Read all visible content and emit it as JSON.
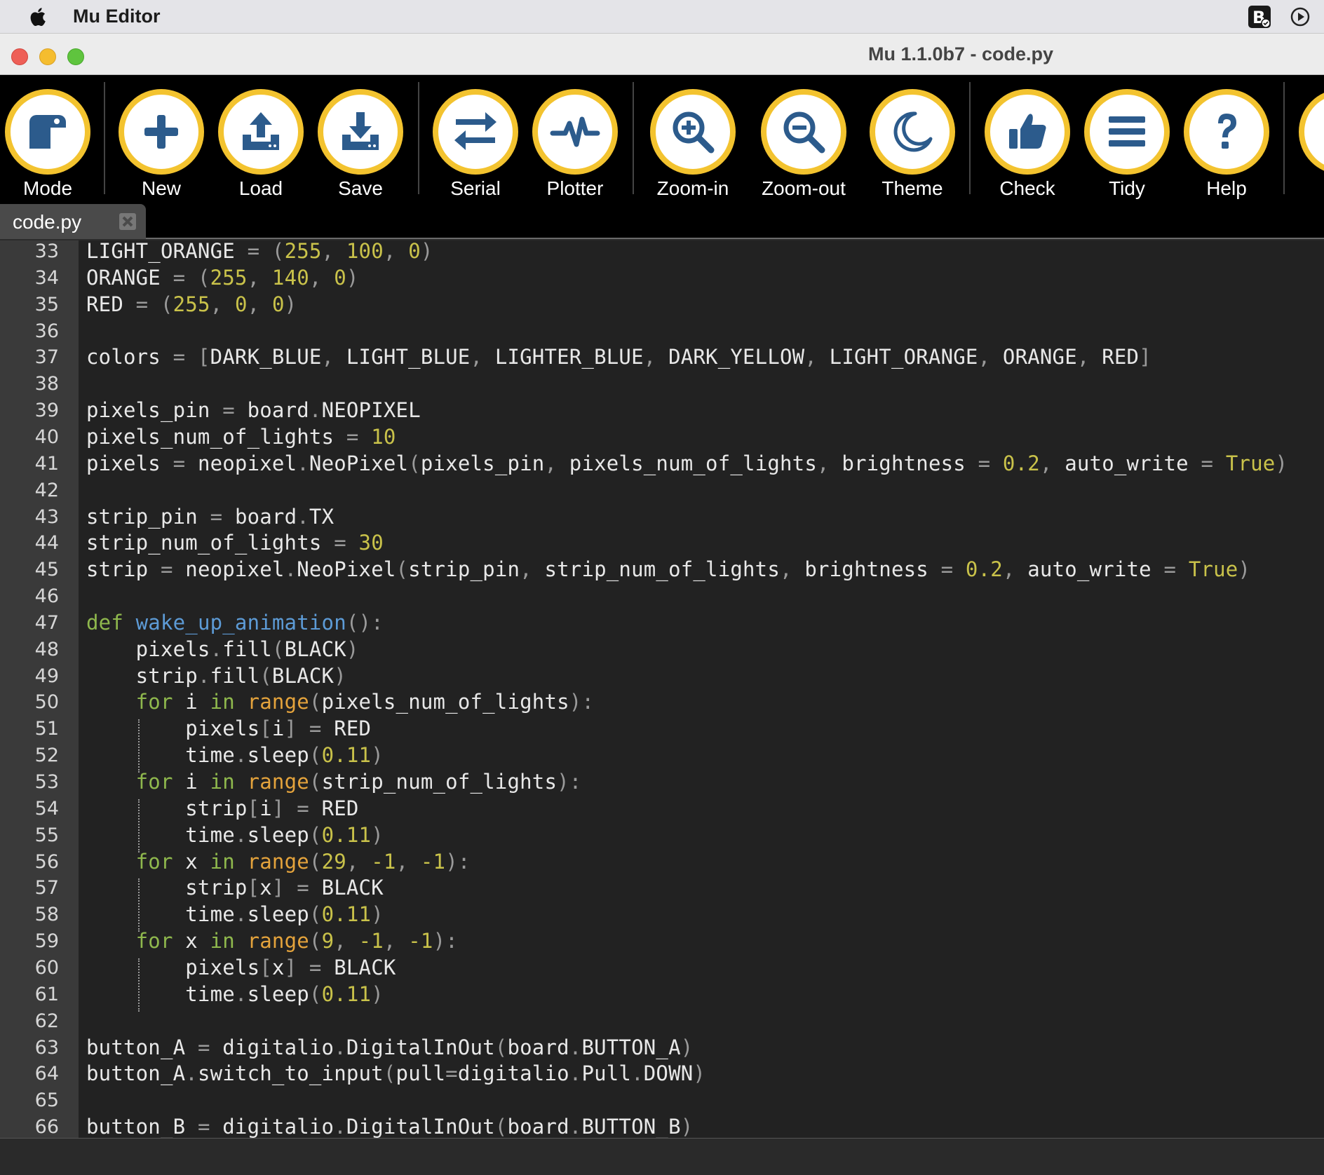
{
  "menubar": {
    "app_name": "Mu Editor",
    "icons": [
      "apple-icon",
      "bbedit-icon",
      "play-circle-icon"
    ]
  },
  "window": {
    "title": "Mu 1.1.0b7 - code.py"
  },
  "toolbar": {
    "buttons": [
      {
        "label": "Mode",
        "icon": "mode-icon"
      },
      {
        "label": "New",
        "icon": "plus-icon"
      },
      {
        "label": "Load",
        "icon": "upload-icon"
      },
      {
        "label": "Save",
        "icon": "download-icon"
      },
      {
        "label": "Serial",
        "icon": "arrows-icon"
      },
      {
        "label": "Plotter",
        "icon": "pulse-icon"
      },
      {
        "label": "Zoom-in",
        "icon": "zoom-in-icon"
      },
      {
        "label": "Zoom-out",
        "icon": "zoom-out-icon"
      },
      {
        "label": "Theme",
        "icon": "moon-icon"
      },
      {
        "label": "Check",
        "icon": "thumbs-up-icon"
      },
      {
        "label": "Tidy",
        "icon": "lines-icon"
      },
      {
        "label": "Help",
        "icon": "question-icon"
      }
    ],
    "accent_color": "#f3c32f",
    "icon_color": "#2c5b8c"
  },
  "tabs": [
    {
      "label": "code.py",
      "close_icon": "close-icon"
    }
  ],
  "colors": {
    "keyword": "#8fb84d",
    "function_def": "#5d9bd6",
    "builtin": "#e4a33c",
    "number": "#c9c24a",
    "punct": "#9a9a9a",
    "text": "#e8e8e8"
  },
  "editor": {
    "lines": [
      {
        "n": "33",
        "tokens": [
          [
            "t",
            "LIGHT_ORANGE "
          ],
          [
            "p",
            "= ("
          ],
          [
            "n",
            "255"
          ],
          [
            "p",
            ", "
          ],
          [
            "n",
            "100"
          ],
          [
            "p",
            ", "
          ],
          [
            "n",
            "0"
          ],
          [
            "p",
            ")"
          ]
        ]
      },
      {
        "n": "34",
        "tokens": [
          [
            "t",
            "ORANGE "
          ],
          [
            "p",
            "= ("
          ],
          [
            "n",
            "255"
          ],
          [
            "p",
            ", "
          ],
          [
            "n",
            "140"
          ],
          [
            "p",
            ", "
          ],
          [
            "n",
            "0"
          ],
          [
            "p",
            ")"
          ]
        ]
      },
      {
        "n": "35",
        "tokens": [
          [
            "t",
            "RED "
          ],
          [
            "p",
            "= ("
          ],
          [
            "n",
            "255"
          ],
          [
            "p",
            ", "
          ],
          [
            "n",
            "0"
          ],
          [
            "p",
            ", "
          ],
          [
            "n",
            "0"
          ],
          [
            "p",
            ")"
          ]
        ]
      },
      {
        "n": "36",
        "tokens": []
      },
      {
        "n": "37",
        "tokens": [
          [
            "t",
            "colors "
          ],
          [
            "p",
            "= ["
          ],
          [
            "t",
            "DARK_BLUE"
          ],
          [
            "p",
            ", "
          ],
          [
            "t",
            "LIGHT_BLUE"
          ],
          [
            "p",
            ", "
          ],
          [
            "t",
            "LIGHTER_BLUE"
          ],
          [
            "p",
            ", "
          ],
          [
            "t",
            "DARK_YELLOW"
          ],
          [
            "p",
            ", "
          ],
          [
            "t",
            "LIGHT_ORANGE"
          ],
          [
            "p",
            ", "
          ],
          [
            "t",
            "ORANGE"
          ],
          [
            "p",
            ", "
          ],
          [
            "t",
            "RED"
          ],
          [
            "p",
            "]"
          ]
        ]
      },
      {
        "n": "38",
        "tokens": []
      },
      {
        "n": "39",
        "tokens": [
          [
            "t",
            "pixels_pin "
          ],
          [
            "p",
            "= "
          ],
          [
            "t",
            "board"
          ],
          [
            "p",
            "."
          ],
          [
            "t",
            "NEOPIXEL"
          ]
        ]
      },
      {
        "n": "40",
        "tokens": [
          [
            "t",
            "pixels_num_of_lights "
          ],
          [
            "p",
            "= "
          ],
          [
            "n",
            "10"
          ]
        ]
      },
      {
        "n": "41",
        "tokens": [
          [
            "t",
            "pixels "
          ],
          [
            "p",
            "= "
          ],
          [
            "t",
            "neopixel"
          ],
          [
            "p",
            "."
          ],
          [
            "t",
            "NeoPixel"
          ],
          [
            "p",
            "("
          ],
          [
            "t",
            "pixels_pin"
          ],
          [
            "p",
            ", "
          ],
          [
            "t",
            "pixels_num_of_lights"
          ],
          [
            "p",
            ", "
          ],
          [
            "t",
            "brightness "
          ],
          [
            "p",
            "= "
          ],
          [
            "n",
            "0.2"
          ],
          [
            "p",
            ", "
          ],
          [
            "t",
            "auto_write "
          ],
          [
            "p",
            "= "
          ],
          [
            "n",
            "True"
          ],
          [
            "p",
            ")"
          ]
        ]
      },
      {
        "n": "42",
        "tokens": []
      },
      {
        "n": "43",
        "tokens": [
          [
            "t",
            "strip_pin "
          ],
          [
            "p",
            "= "
          ],
          [
            "t",
            "board"
          ],
          [
            "p",
            "."
          ],
          [
            "t",
            "TX"
          ]
        ]
      },
      {
        "n": "44",
        "tokens": [
          [
            "t",
            "strip_num_of_lights "
          ],
          [
            "p",
            "= "
          ],
          [
            "n",
            "30"
          ]
        ]
      },
      {
        "n": "45",
        "tokens": [
          [
            "t",
            "strip "
          ],
          [
            "p",
            "= "
          ],
          [
            "t",
            "neopixel"
          ],
          [
            "p",
            "."
          ],
          [
            "t",
            "NeoPixel"
          ],
          [
            "p",
            "("
          ],
          [
            "t",
            "strip_pin"
          ],
          [
            "p",
            ", "
          ],
          [
            "t",
            "strip_num_of_lights"
          ],
          [
            "p",
            ", "
          ],
          [
            "t",
            "brightness "
          ],
          [
            "p",
            "= "
          ],
          [
            "n",
            "0.2"
          ],
          [
            "p",
            ", "
          ],
          [
            "t",
            "auto_write "
          ],
          [
            "p",
            "= "
          ],
          [
            "n",
            "True"
          ],
          [
            "p",
            ")"
          ]
        ]
      },
      {
        "n": "46",
        "tokens": []
      },
      {
        "n": "47",
        "tokens": [
          [
            "k",
            "def "
          ],
          [
            "f",
            "wake_up_animation"
          ],
          [
            "p",
            "():"
          ]
        ]
      },
      {
        "n": "48",
        "tokens": [
          [
            "t",
            "    pixels"
          ],
          [
            "p",
            "."
          ],
          [
            "t",
            "fill"
          ],
          [
            "p",
            "("
          ],
          [
            "t",
            "BLACK"
          ],
          [
            "p",
            ")"
          ]
        ]
      },
      {
        "n": "49",
        "tokens": [
          [
            "t",
            "    strip"
          ],
          [
            "p",
            "."
          ],
          [
            "t",
            "fill"
          ],
          [
            "p",
            "("
          ],
          [
            "t",
            "BLACK"
          ],
          [
            "p",
            ")"
          ]
        ]
      },
      {
        "n": "50",
        "tokens": [
          [
            "t",
            "    "
          ],
          [
            "k",
            "for "
          ],
          [
            "t",
            "i "
          ],
          [
            "k",
            "in "
          ],
          [
            "b",
            "range"
          ],
          [
            "p",
            "("
          ],
          [
            "t",
            "pixels_num_of_lights"
          ],
          [
            "p",
            "):"
          ]
        ]
      },
      {
        "n": "51",
        "tokens": [
          [
            "t",
            "        pixels"
          ],
          [
            "p",
            "["
          ],
          [
            "t",
            "i"
          ],
          [
            "p",
            "] = "
          ],
          [
            "t",
            "RED"
          ]
        ]
      },
      {
        "n": "52",
        "tokens": [
          [
            "t",
            "        time"
          ],
          [
            "p",
            "."
          ],
          [
            "t",
            "sleep"
          ],
          [
            "p",
            "("
          ],
          [
            "n",
            "0.11"
          ],
          [
            "p",
            ")"
          ]
        ]
      },
      {
        "n": "53",
        "tokens": [
          [
            "t",
            "    "
          ],
          [
            "k",
            "for "
          ],
          [
            "t",
            "i "
          ],
          [
            "k",
            "in "
          ],
          [
            "b",
            "range"
          ],
          [
            "p",
            "("
          ],
          [
            "t",
            "strip_num_of_lights"
          ],
          [
            "p",
            "):"
          ]
        ]
      },
      {
        "n": "54",
        "tokens": [
          [
            "t",
            "        strip"
          ],
          [
            "p",
            "["
          ],
          [
            "t",
            "i"
          ],
          [
            "p",
            "] = "
          ],
          [
            "t",
            "RED"
          ]
        ]
      },
      {
        "n": "55",
        "tokens": [
          [
            "t",
            "        time"
          ],
          [
            "p",
            "."
          ],
          [
            "t",
            "sleep"
          ],
          [
            "p",
            "("
          ],
          [
            "n",
            "0.11"
          ],
          [
            "p",
            ")"
          ]
        ]
      },
      {
        "n": "56",
        "tokens": [
          [
            "t",
            "    "
          ],
          [
            "k",
            "for "
          ],
          [
            "t",
            "x "
          ],
          [
            "k",
            "in "
          ],
          [
            "b",
            "range"
          ],
          [
            "p",
            "("
          ],
          [
            "n",
            "29"
          ],
          [
            "p",
            ", "
          ],
          [
            "n",
            "-1"
          ],
          [
            "p",
            ", "
          ],
          [
            "n",
            "-1"
          ],
          [
            "p",
            "):"
          ]
        ]
      },
      {
        "n": "57",
        "tokens": [
          [
            "t",
            "        strip"
          ],
          [
            "p",
            "["
          ],
          [
            "t",
            "x"
          ],
          [
            "p",
            "] = "
          ],
          [
            "t",
            "BLACK"
          ]
        ]
      },
      {
        "n": "58",
        "tokens": [
          [
            "t",
            "        time"
          ],
          [
            "p",
            "."
          ],
          [
            "t",
            "sleep"
          ],
          [
            "p",
            "("
          ],
          [
            "n",
            "0.11"
          ],
          [
            "p",
            ")"
          ]
        ]
      },
      {
        "n": "59",
        "tokens": [
          [
            "t",
            "    "
          ],
          [
            "k",
            "for "
          ],
          [
            "t",
            "x "
          ],
          [
            "k",
            "in "
          ],
          [
            "b",
            "range"
          ],
          [
            "p",
            "("
          ],
          [
            "n",
            "9"
          ],
          [
            "p",
            ", "
          ],
          [
            "n",
            "-1"
          ],
          [
            "p",
            ", "
          ],
          [
            "n",
            "-1"
          ],
          [
            "p",
            "):"
          ]
        ]
      },
      {
        "n": "60",
        "tokens": [
          [
            "t",
            "        pixels"
          ],
          [
            "p",
            "["
          ],
          [
            "t",
            "x"
          ],
          [
            "p",
            "] = "
          ],
          [
            "t",
            "BLACK"
          ]
        ]
      },
      {
        "n": "61",
        "tokens": [
          [
            "t",
            "        time"
          ],
          [
            "p",
            "."
          ],
          [
            "t",
            "sleep"
          ],
          [
            "p",
            "("
          ],
          [
            "n",
            "0.11"
          ],
          [
            "p",
            ")"
          ]
        ]
      },
      {
        "n": "62",
        "tokens": []
      },
      {
        "n": "63",
        "tokens": [
          [
            "t",
            "button_A "
          ],
          [
            "p",
            "= "
          ],
          [
            "t",
            "digitalio"
          ],
          [
            "p",
            "."
          ],
          [
            "t",
            "DigitalInOut"
          ],
          [
            "p",
            "("
          ],
          [
            "t",
            "board"
          ],
          [
            "p",
            "."
          ],
          [
            "t",
            "BUTTON_A"
          ],
          [
            "p",
            ")"
          ]
        ]
      },
      {
        "n": "64",
        "tokens": [
          [
            "t",
            "button_A"
          ],
          [
            "p",
            "."
          ],
          [
            "t",
            "switch_to_input"
          ],
          [
            "p",
            "("
          ],
          [
            "t",
            "pull"
          ],
          [
            "p",
            "="
          ],
          [
            "t",
            "digitalio"
          ],
          [
            "p",
            "."
          ],
          [
            "t",
            "Pull"
          ],
          [
            "p",
            "."
          ],
          [
            "t",
            "DOWN"
          ],
          [
            "p",
            ")"
          ]
        ]
      },
      {
        "n": "65",
        "tokens": []
      },
      {
        "n": "66",
        "tokens": [
          [
            "t",
            "button_B "
          ],
          [
            "p",
            "= "
          ],
          [
            "t",
            "digitalio"
          ],
          [
            "p",
            "."
          ],
          [
            "t",
            "DigitalInOut"
          ],
          [
            "p",
            "("
          ],
          [
            "t",
            "board"
          ],
          [
            "p",
            "."
          ],
          [
            "t",
            "BUTTON_B"
          ],
          [
            "p",
            ")"
          ]
        ]
      }
    ]
  }
}
